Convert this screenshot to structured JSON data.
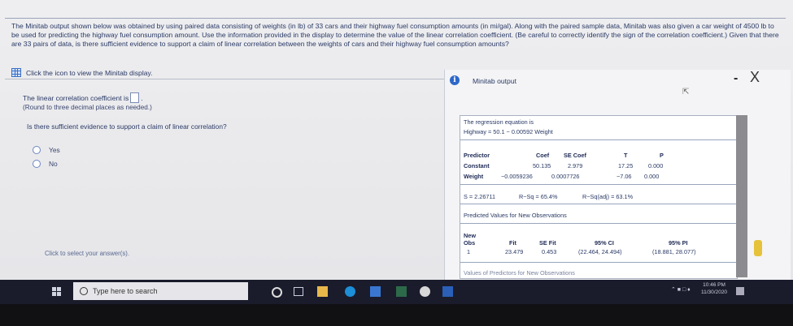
{
  "question": {
    "text": "The Minitab output shown below was obtained by using paired data consisting of weights (in lb) of 33 cars and their highway fuel consumption amounts (in mi/gal). Along with the paired sample data, Minitab was also given a car weight of 4500 lb to be used for predicting the highway fuel consumption amount. Use the information provided in the display to determine the value of the linear correlation coefficient. (Be careful to correctly identify the sign of the correlation coefficient.) Given that there are 33 pairs of data, is there sufficient evidence to support a claim of linear correlation between the weights of cars and their highway fuel consumption amounts?",
    "icon_prompt": "Click the icon to view the Minitab display."
  },
  "answer": {
    "lcc_label": "The linear correlation coefficient is",
    "round_note": "(Round to three decimal places as needed.)",
    "evidence_question": "Is there sufficient evidence to support a claim of linear correlation?",
    "options": [
      "Yes",
      "No"
    ],
    "click_hint": "Click to select your answer(s)."
  },
  "popup": {
    "title": "Minitab output",
    "minimize": "-",
    "close": "X",
    "regression_heading": "The regression equation is",
    "regression_equation": "Highway = 50.1 − 0.00592 Weight",
    "coef_headers": [
      "Predictor",
      "Coef",
      "SE Coef",
      "T",
      "P"
    ],
    "coef_rows": [
      [
        "Constant",
        "50.135",
        "2.979",
        "17.25",
        "0.000"
      ],
      [
        "Weight",
        "−0.0059236",
        "0.0007726",
        "−7.06",
        "0.000"
      ]
    ],
    "s": "S = 2.26711",
    "rsq": "R−Sq = 65.4%",
    "rsq_adj": "R−Sq(adj) = 63.1%",
    "pred_heading": "Predicted Values for New Observations",
    "pred_headers": [
      "New",
      "Obs",
      "Fit",
      "SE Fit",
      "95% CI",
      "95% PI"
    ],
    "pred_row": [
      "1",
      "23.479",
      "0.453",
      "(22.464, 24.494)",
      "(18.881, 28.077)"
    ],
    "values_heading": "Values of Predictors for New Observations"
  },
  "taskbar": {
    "search_placeholder": "Type here to search",
    "time": "10:46 PM",
    "date": "11/30/2020"
  }
}
